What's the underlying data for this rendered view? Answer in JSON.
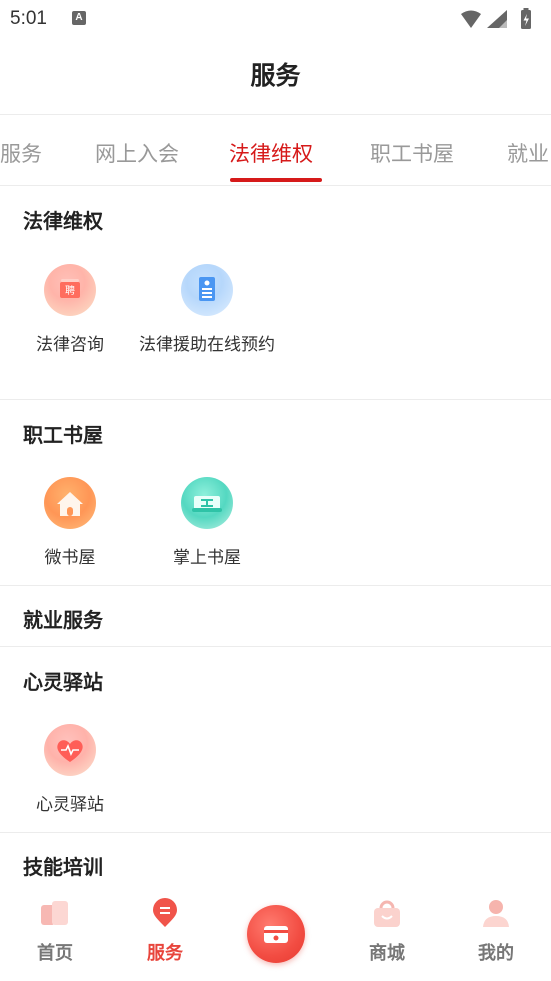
{
  "status_bar": {
    "time": "5:01",
    "notification_icon": "A"
  },
  "header": {
    "title": "服务"
  },
  "tabs": [
    {
      "label": "服务"
    },
    {
      "label": "网上入会"
    },
    {
      "label": "法律维权",
      "active": true
    },
    {
      "label": "职工书屋"
    },
    {
      "label": "就业"
    }
  ],
  "sections": [
    {
      "title": "法律维权",
      "items": [
        {
          "label": "法律咨询",
          "icon": "legal-consult-icon"
        },
        {
          "label": "法律援助在线预约",
          "icon": "legal-aid-icon"
        }
      ]
    },
    {
      "title": "职工书屋",
      "items": [
        {
          "label": "微书屋",
          "icon": "house-icon"
        },
        {
          "label": "掌上书屋",
          "icon": "book-icon"
        }
      ]
    },
    {
      "title": "就业服务",
      "items": []
    },
    {
      "title": "心灵驿站",
      "items": [
        {
          "label": "心灵驿站",
          "icon": "heart-icon"
        }
      ]
    },
    {
      "title": "技能培训",
      "items": []
    }
  ],
  "bottom_nav": [
    {
      "label": "首页",
      "icon": "home-icon"
    },
    {
      "label": "服务",
      "icon": "service-icon",
      "active": true
    },
    {
      "label": "",
      "icon": "wallet-icon"
    },
    {
      "label": "商城",
      "icon": "shop-icon"
    },
    {
      "label": "我的",
      "icon": "profile-icon"
    }
  ],
  "colors": {
    "accent": "#d61a1a",
    "nav_active": "#e8453c",
    "tab_inactive": "#999999"
  }
}
